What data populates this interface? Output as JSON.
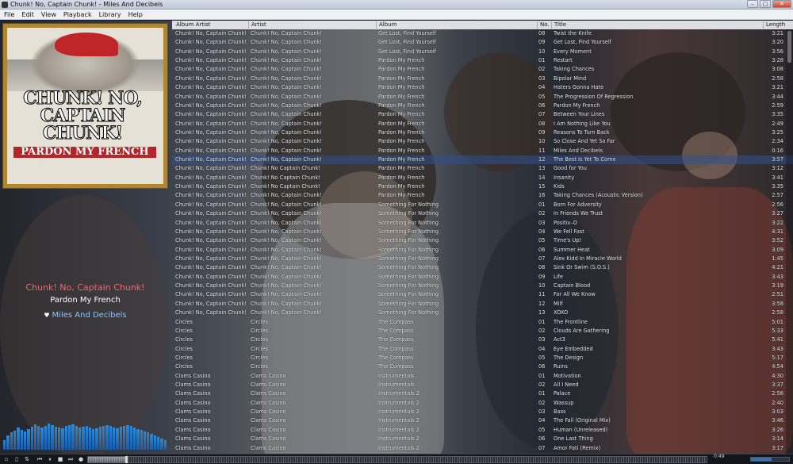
{
  "window": {
    "title": "Chunk! No, Captain Chunk! - Miles And Decibels"
  },
  "menu": [
    "File",
    "Edit",
    "View",
    "Playback",
    "Library",
    "Help"
  ],
  "album_art": {
    "band_text": "CHUNK! NO, CAPTAIN CHUNK!",
    "record_title": "PARDON MY FRENCH"
  },
  "now_playing": {
    "artist": "Chunk! No, Captain Chunk!",
    "album": "Pardon My French",
    "title": "Miles And Decibels",
    "heart_icon": "heart-icon"
  },
  "columns": {
    "album_artist": "Album Artist",
    "artist": "Artist",
    "album": "Album",
    "no": "No.",
    "title": "Title",
    "length": "Length"
  },
  "playing_index": 14,
  "playback": {
    "time": "0:49",
    "position_fraction": 0.06,
    "volume_fraction": 0.55
  },
  "colors": {
    "playing_row": "#32508c",
    "now_playing_artist": "#e66a76",
    "now_playing_title": "#8ec2ff",
    "spectrum": "#2b8bd8"
  },
  "spectrum_levels": [
    0.3,
    0.45,
    0.55,
    0.6,
    0.7,
    0.62,
    0.58,
    0.66,
    0.72,
    0.8,
    0.74,
    0.7,
    0.75,
    0.82,
    0.78,
    0.72,
    0.7,
    0.68,
    0.74,
    0.78,
    0.8,
    0.76,
    0.7,
    0.72,
    0.74,
    0.7,
    0.66,
    0.68,
    0.72,
    0.75,
    0.78,
    0.74,
    0.7,
    0.68,
    0.72,
    0.76,
    0.78,
    0.74,
    0.7,
    0.65,
    0.62,
    0.58,
    0.55,
    0.5,
    0.45,
    0.4,
    0.35,
    0.3
  ],
  "tracks": [
    [
      "Chunk! No, Captain Chunk!",
      "Chunk! No, Captain Chunk!",
      "Get Lost, Find Yourself",
      "08",
      "Twist the Knife",
      "3:21"
    ],
    [
      "Chunk! No, Captain Chunk!",
      "Chunk! No, Captain Chunk!",
      "Get Lost, Find Yourself",
      "09",
      "Get Lost, Find Yourself",
      "3:20"
    ],
    [
      "Chunk! No, Captain Chunk!",
      "Chunk! No, Captain Chunk!",
      "Get Lost, Find Yourself",
      "10",
      "Every Moment",
      "3:56"
    ],
    [
      "Chunk! No, Captain Chunk!",
      "Chunk! No, Captain Chunk!",
      "Pardon My French",
      "01",
      "Restart",
      "3:28"
    ],
    [
      "Chunk! No, Captain Chunk!",
      "Chunk! No, Captain Chunk!",
      "Pardon My French",
      "02",
      "Taking Chances",
      "3:08"
    ],
    [
      "Chunk! No, Captain Chunk!",
      "Chunk! No, Captain Chunk!",
      "Pardon My French",
      "03",
      "Bipolar Mind",
      "2:58"
    ],
    [
      "Chunk! No, Captain Chunk!",
      "Chunk! No, Captain Chunk!",
      "Pardon My French",
      "04",
      "Haters Gonna Hate",
      "3:21"
    ],
    [
      "Chunk! No, Captain Chunk!",
      "Chunk! No, Captain Chunk!",
      "Pardon My French",
      "05",
      "The Progression Of Regression",
      "3:44"
    ],
    [
      "Chunk! No, Captain Chunk!",
      "Chunk! No, Captain Chunk!",
      "Pardon My French",
      "06",
      "Pardon My French",
      "2:59"
    ],
    [
      "Chunk! No, Captain Chunk!",
      "Chunk! No, Captain Chunk!",
      "Pardon My French",
      "07",
      "Between Your Lines",
      "3:35"
    ],
    [
      "Chunk! No, Captain Chunk!",
      "Chunk! No, Captain Chunk!",
      "Pardon My French",
      "08",
      "I Am Nothing Like You",
      "2:49"
    ],
    [
      "Chunk! No, Captain Chunk!",
      "Chunk! No, Captain Chunk!",
      "Pardon My French",
      "09",
      "Reasons To Turn Back",
      "3:25"
    ],
    [
      "Chunk! No, Captain Chunk!",
      "Chunk! No, Captain Chunk!",
      "Pardon My French",
      "10",
      "So Close And Yet So Far",
      "2:34"
    ],
    [
      "Chunk! No, Captain Chunk!",
      "Chunk! No, Captain Chunk!",
      "Pardon My French",
      "11",
      "Miles And Decibels",
      "0:16"
    ],
    [
      "Chunk! No, Captain Chunk!",
      "Chunk! No, Captain Chunk!",
      "Pardon My French",
      "12",
      "The Best Is Yet To Come",
      "3:57"
    ],
    [
      "Chunk! No, Captain Chunk!",
      "Chunk! No Captain Chunk!",
      "Pardon My French",
      "13",
      "Good for You",
      "3:12"
    ],
    [
      "Chunk! No, Captain Chunk!",
      "Chunk! No Captain Chunk!",
      "Pardon My French",
      "14",
      "Insanity",
      "3:41"
    ],
    [
      "Chunk! No, Captain Chunk!",
      "Chunk! No Captain Chunk!",
      "Pardon My French",
      "15",
      "Kids",
      "3:35"
    ],
    [
      "Chunk! No, Captain Chunk!",
      "Chunk! No, Captain Chunk!",
      "Pardon My French",
      "16",
      "Taking Chances (Acoustic Version)",
      "2:57"
    ],
    [
      "Chunk! No, Captain Chunk!",
      "Chunk! No, Captain Chunk!",
      "Something For Nothing",
      "01",
      "Born For Adversity",
      "2:56"
    ],
    [
      "Chunk! No, Captain Chunk!",
      "Chunk! No, Captain Chunk!",
      "Something For Nothing",
      "02",
      "In Friends We Trust",
      "3:27"
    ],
    [
      "Chunk! No, Captain Chunk!",
      "Chunk! No, Captain Chunk!",
      "Something For Nothing",
      "03",
      "Positiv–O",
      "3:22"
    ],
    [
      "Chunk! No, Captain Chunk!",
      "Chunk! No, Captain Chunk!",
      "Something For Nothing",
      "04",
      "We Fell Fast",
      "4:31"
    ],
    [
      "Chunk! No, Captain Chunk!",
      "Chunk! No, Captain Chunk!",
      "Something For Nothing",
      "05",
      "Time's Up!",
      "3:52"
    ],
    [
      "Chunk! No, Captain Chunk!",
      "Chunk! No, Captain Chunk!",
      "Something For Nothing",
      "06",
      "Summer Heat",
      "3:09"
    ],
    [
      "Chunk! No, Captain Chunk!",
      "Chunk! No, Captain Chunk!",
      "Something For Nothing",
      "07",
      "Alex Kidd In Miracle World",
      "1:45"
    ],
    [
      "Chunk! No, Captain Chunk!",
      "Chunk! No, Captain Chunk!",
      "Something For Nothing",
      "08",
      "Sink Or Swim (S.O.S.)",
      "4:21"
    ],
    [
      "Chunk! No, Captain Chunk!",
      "Chunk! No, Captain Chunk!",
      "Something For Nothing",
      "09",
      "Life",
      "3:43"
    ],
    [
      "Chunk! No, Captain Chunk!",
      "Chunk! No, Captain Chunk!",
      "Something For Nothing",
      "10",
      "Captain Blood",
      "3:19"
    ],
    [
      "Chunk! No, Captain Chunk!",
      "Chunk! No, Captain Chunk!",
      "Something For Nothing",
      "11",
      "For All We Know",
      "2:51"
    ],
    [
      "Chunk! No, Captain Chunk!",
      "Chunk! No, Captain Chunk!",
      "Something For Nothing",
      "12",
      "Milf",
      "3:58"
    ],
    [
      "Chunk! No, Captain Chunk!",
      "Chunk! No, Captain Chunk!",
      "Something For Nothing",
      "13",
      "XOXO",
      "2:58"
    ],
    [
      "Circles",
      "Circles",
      "The Compass",
      "01",
      "The Frontline",
      "5:01"
    ],
    [
      "Circles",
      "Circles",
      "The Compass",
      "02",
      "Clouds Are Gathering",
      "5:33"
    ],
    [
      "Circles",
      "Circles",
      "The Compass",
      "03",
      "Act3",
      "5:41"
    ],
    [
      "Circles",
      "Circles",
      "The Compass",
      "04",
      "Eye Embedded",
      "3:43"
    ],
    [
      "Circles",
      "Circles",
      "The Compass",
      "05",
      "The Design",
      "5:17"
    ],
    [
      "Circles",
      "Circles",
      "The Compass",
      "06",
      "Ruins",
      "4:54"
    ],
    [
      "Clams Casino",
      "Clams Casino",
      "Instrumentals",
      "01",
      "Motivation",
      "4:30"
    ],
    [
      "Clams Casino",
      "Clams Casino",
      "Instrumentals",
      "02",
      "All I Need",
      "3:37"
    ],
    [
      "Clams Casino",
      "Clams Casino",
      "Instrumentals 2",
      "01",
      "Palace",
      "2:56"
    ],
    [
      "Clams Casino",
      "Clams Casino",
      "Instrumentals 2",
      "02",
      "Wassup",
      "2:40"
    ],
    [
      "Clams Casino",
      "Clams Casino",
      "Instrumentals 2",
      "03",
      "Bass",
      "3:03"
    ],
    [
      "Clams Casino",
      "Clams Casino",
      "Instrumentals 2",
      "04",
      "The Fall (Original Mix)",
      "3:46"
    ],
    [
      "Clams Casino",
      "Clams Casino",
      "Instrumentals 2",
      "05",
      "Human (Unreleased)",
      "3:26"
    ],
    [
      "Clams Casino",
      "Clams Casino",
      "Instrumentals 2",
      "06",
      "One Last Thing",
      "3:14"
    ],
    [
      "Clams Casino",
      "Clams Casino",
      "Instrumentals 2",
      "07",
      "Amor Fati (Remix)",
      "3:17"
    ]
  ]
}
